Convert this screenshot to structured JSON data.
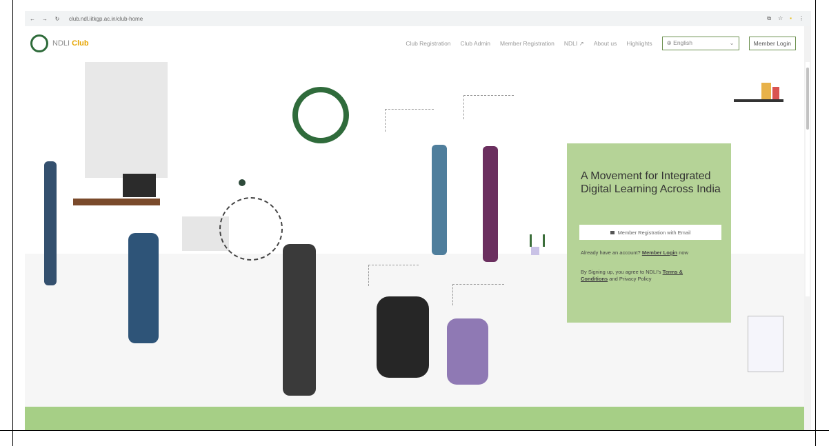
{
  "browser": {
    "url": "club.ndl.iitkgp.ac.in/club-home"
  },
  "header": {
    "brand_main": "NDLI",
    "brand_accent": "Club",
    "menu": [
      "Club Registration",
      "Club Admin",
      "Member Registration",
      "NDLI",
      "About us",
      "Highlights"
    ],
    "language_selected": "English",
    "login_label": "Member Login"
  },
  "hero": {
    "title": "A Movement for Integrated Digital Learning Across India",
    "register_button": "Member Registration with Email",
    "already_text": "Already have an account?",
    "login_link": "Member Login",
    "login_suffix": "now",
    "terms_prefix": "By Signing up, you agree to NDLI's",
    "terms_link": "Terms & Conditions",
    "terms_suffix": "and Privacy Policy"
  },
  "colors": {
    "accent_green": "#b5d397",
    "band_green": "#a6cf86",
    "brand_yellow": "#e6a400",
    "emblem_green": "#2f6b3b"
  }
}
